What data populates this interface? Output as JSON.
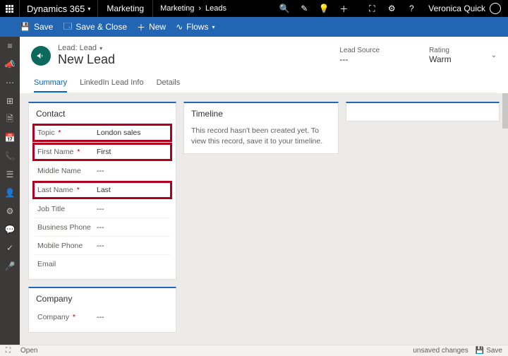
{
  "topbar": {
    "brand": "Dynamics 365",
    "area": "Marketing",
    "breadcrumb": [
      "Marketing",
      "Leads"
    ],
    "user": "Veronica Quick"
  },
  "commands": {
    "save": "Save",
    "saveClose": "Save & Close",
    "new": "New",
    "flows": "Flows"
  },
  "header": {
    "entityType": "Lead: Lead",
    "entityName": "New Lead",
    "fields": [
      {
        "label": "Lead Source",
        "value": "---"
      },
      {
        "label": "Rating",
        "value": "Warm"
      }
    ]
  },
  "tabs": [
    {
      "label": "Summary",
      "active": true
    },
    {
      "label": "LinkedIn Lead Info",
      "active": false
    },
    {
      "label": "Details",
      "active": false
    }
  ],
  "contact": {
    "title": "Contact",
    "rows": [
      {
        "label": "Topic",
        "required": true,
        "value": "London sales",
        "hl": true
      },
      {
        "label": "First Name",
        "required": true,
        "value": "First",
        "hl": true
      },
      {
        "label": "Middle Name",
        "required": false,
        "value": "---",
        "hl": false
      },
      {
        "label": "Last Name",
        "required": true,
        "value": "Last",
        "hl": true
      },
      {
        "label": "Job Title",
        "required": false,
        "value": "---",
        "hl": false
      },
      {
        "label": "Business Phone",
        "required": false,
        "value": "---",
        "hl": false
      },
      {
        "label": "Mobile Phone",
        "required": false,
        "value": "---",
        "hl": false
      },
      {
        "label": "Email",
        "required": false,
        "value": "",
        "hl": false
      }
    ]
  },
  "company": {
    "title": "Company",
    "rows": [
      {
        "label": "Company",
        "required": true,
        "value": "---"
      }
    ]
  },
  "timeline": {
    "title": "Timeline",
    "message": "This record hasn't been created yet. To view this record, save it to your timeline."
  },
  "status": {
    "open": "Open",
    "unsaved": "unsaved changes",
    "save": "Save"
  }
}
